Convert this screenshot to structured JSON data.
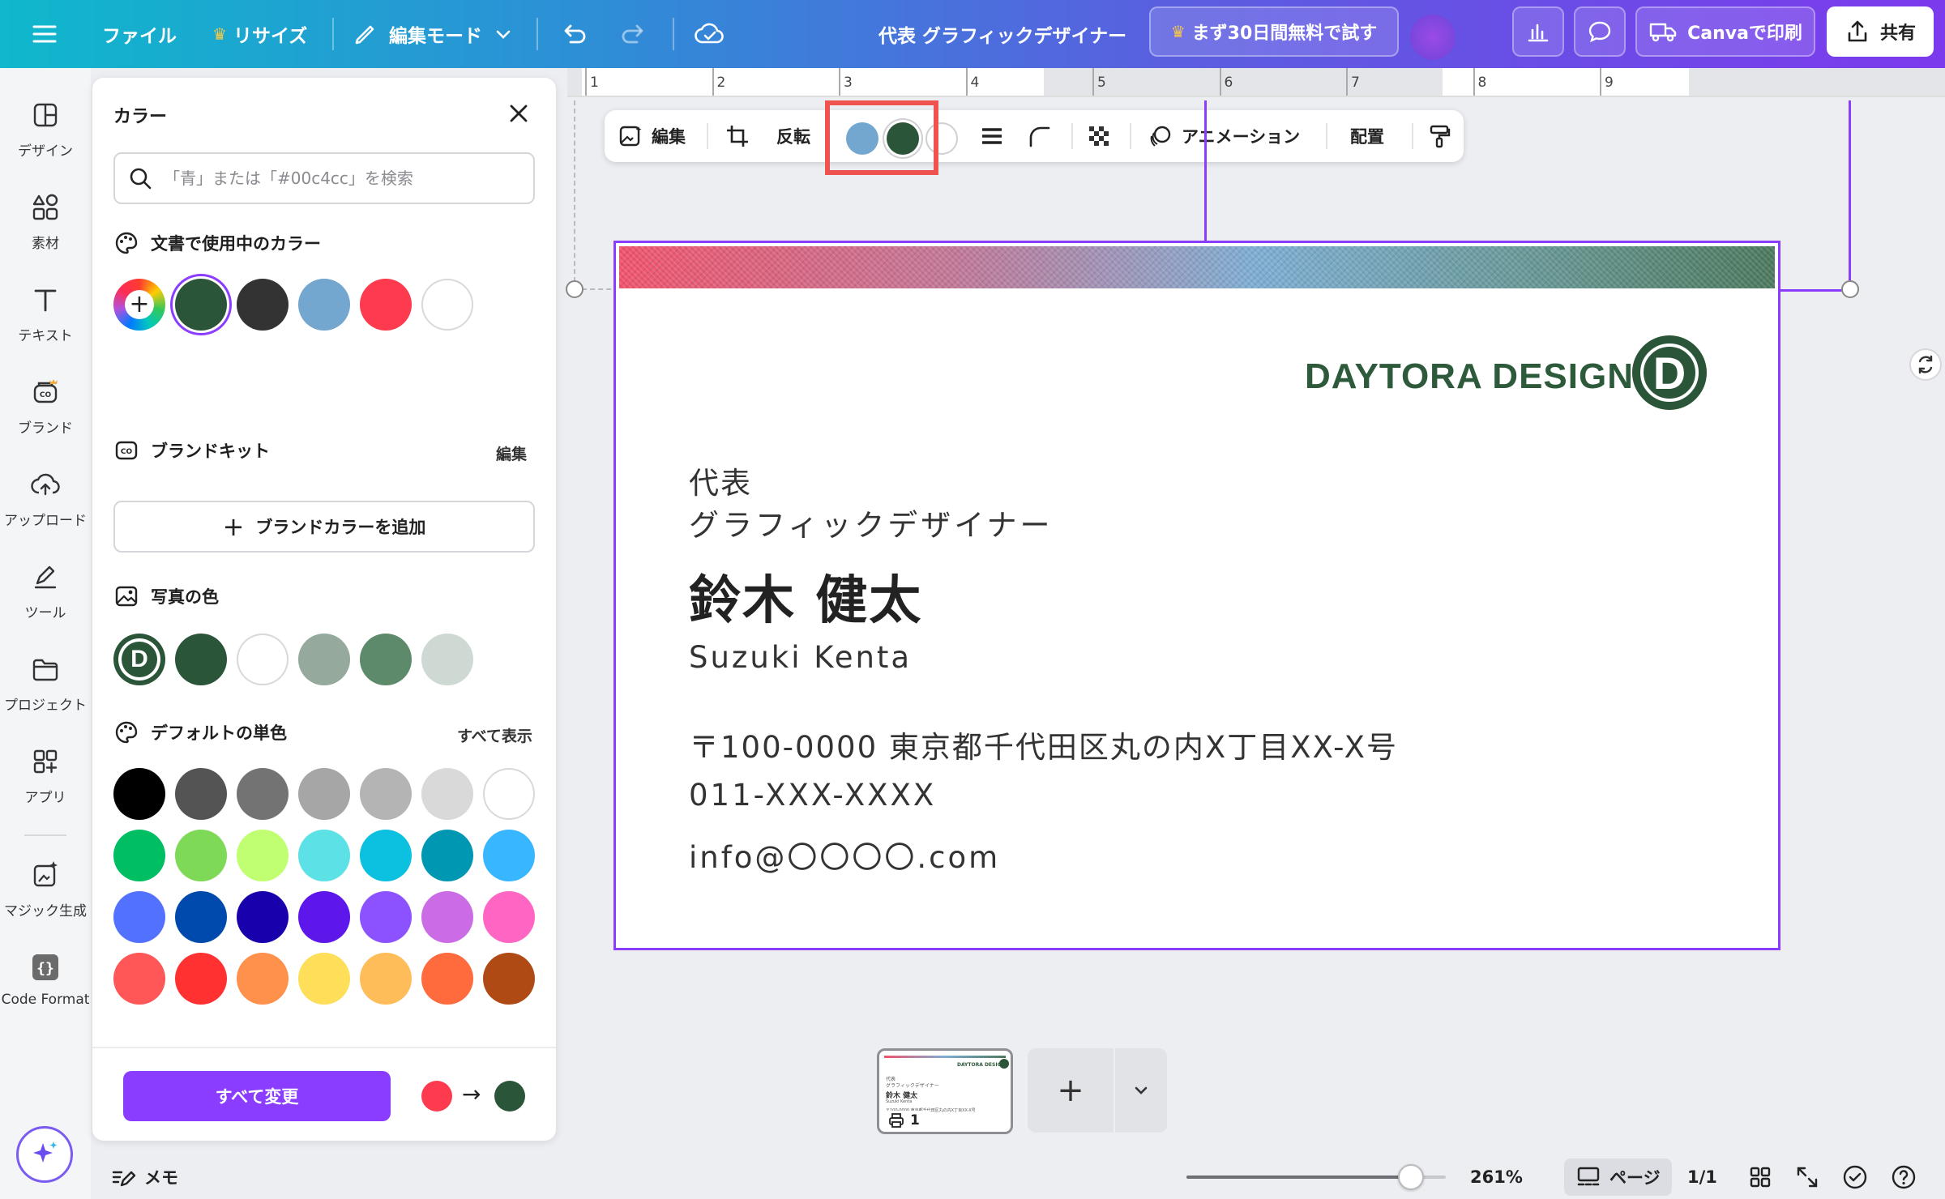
{
  "topbar": {
    "file_label": "ファイル",
    "resize_label": "リサイズ",
    "edit_mode_label": "編集モード",
    "doc_title": "代表 グラフィックデザイナー",
    "trial_label": "まず30日間無料で試す",
    "print_label": "Canvaで印刷",
    "share_label": "共有"
  },
  "rail": {
    "items": [
      {
        "label": "デザイン",
        "icon": "design-icon"
      },
      {
        "label": "素材",
        "icon": "elements-icon"
      },
      {
        "label": "テキスト",
        "icon": "text-icon"
      },
      {
        "label": "ブランド",
        "icon": "brand-icon"
      },
      {
        "label": "アップロード",
        "icon": "upload-icon"
      },
      {
        "label": "ツール",
        "icon": "tools-icon"
      },
      {
        "label": "プロジェクト",
        "icon": "folder-icon"
      },
      {
        "label": "アプリ",
        "icon": "apps-icon"
      },
      {
        "label": "マジック生成",
        "icon": "magic-icon"
      },
      {
        "label": "Code Format",
        "icon": "code-icon"
      }
    ]
  },
  "panel": {
    "title": "カラー",
    "search_placeholder": "「青」または「#00c4cc」を検索",
    "doc_colors_title": "文書で使用中のカラー",
    "doc_colors": [
      "#2b5538",
      "#333333",
      "#74a7cf",
      "#fe3a4e",
      "#ffffff"
    ],
    "brand_kit_title": "ブランドキット",
    "brand_kit_edit": "編集",
    "brand_add_label": "ブランドカラーを追加",
    "photo_colors_title": "写真の色",
    "photo_colors": [
      "#2b5538",
      "#ffffff",
      "#95a99c",
      "#5e8a6c",
      "#cfd9d3"
    ],
    "default_colors_title": "デフォルトの単色",
    "show_all_label": "すべて表示",
    "default_colors": [
      [
        "#000000",
        "#545454",
        "#737373",
        "#a6a6a6",
        "#b4b4b4",
        "#d9d9d9",
        "#ffffff"
      ],
      [
        "#00bf63",
        "#7ed957",
        "#c1ff72",
        "#5ce1e6",
        "#0cc0df",
        "#0097b2",
        "#38b6ff"
      ],
      [
        "#5271ff",
        "#004aad",
        "#1800ad",
        "#5e17eb",
        "#8c52ff",
        "#cb6ce6",
        "#ff66c4"
      ],
      [
        "#ff5757",
        "#ff3131",
        "#ff914d",
        "#ffde59",
        "#ffbd59",
        "#ff6b3d",
        "#b04a14"
      ]
    ],
    "change_all_label": "すべて変更",
    "change_from": "#fe3a4e",
    "change_to": "#2b5538"
  },
  "ruler": {
    "ticks": [
      "1",
      "2",
      "3",
      "4",
      "5",
      "6",
      "7",
      "8",
      "9"
    ]
  },
  "toolbar": {
    "edit_label": "編集",
    "flip_label": "反転",
    "color_1": "#74a7cf",
    "color_2": "#2b5538",
    "animation_label": "アニメーション",
    "position_label": "配置"
  },
  "card": {
    "logo_text": "DAYTORA DESIGN",
    "logo_letter": "D",
    "role": "代表",
    "job_title": "グラフィックデザイナー",
    "name": "鈴木 健太",
    "name_roman": "Suzuki Kenta",
    "address": "〒100-0000 東京都千代田区丸の内X丁目XX-X号",
    "phone": "011-XXX-XXXX",
    "email": "info@〇〇〇〇.com"
  },
  "pages": {
    "thumb_number": "1"
  },
  "bottombar": {
    "notes_label": "メモ",
    "zoom_value": 261,
    "zoom_label": "261%",
    "page_label": "ページ",
    "page_count": "1/1"
  }
}
